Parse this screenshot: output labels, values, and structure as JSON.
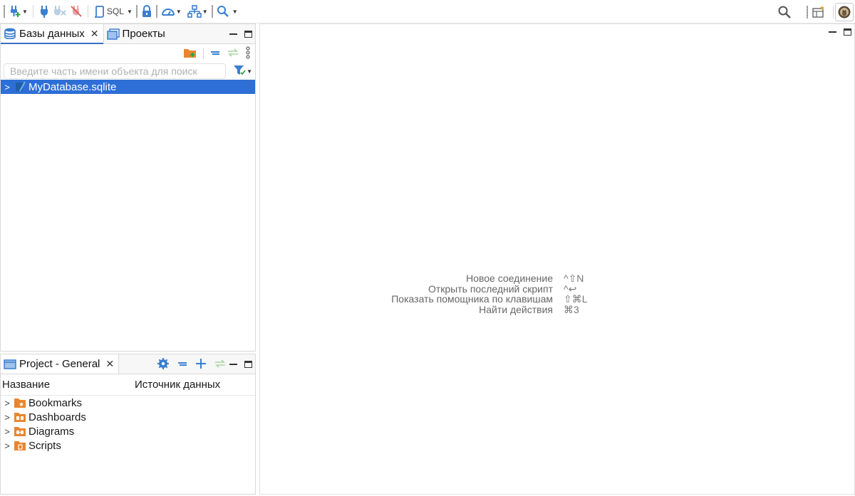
{
  "toolbar": {
    "sql_label": "SQL",
    "icons": [
      "new-connection-icon",
      "connect-icon",
      "disconnect-icon",
      "disconnect-all-icon",
      "sql-editor-icon",
      "lock-icon",
      "dashboard-icon",
      "network-icon",
      "search-icon",
      "global-search-icon",
      "perspective-icon",
      "avatar"
    ]
  },
  "left_top": {
    "tabs": [
      {
        "label": "Базы данных",
        "closable": true,
        "active": true
      },
      {
        "label": "Проекты",
        "closable": false,
        "active": false
      }
    ],
    "filter_placeholder": "Введите часть имени объекта для поиск",
    "tree": [
      {
        "label": "MyDatabase.sqlite",
        "selected": true
      }
    ]
  },
  "left_bottom": {
    "tab_label": "Project - General",
    "columns": [
      "Название",
      "Источник данных"
    ],
    "items": [
      {
        "label": "Bookmarks",
        "icon": "bookmarks-folder-icon"
      },
      {
        "label": "Dashboards",
        "icon": "dashboards-folder-icon"
      },
      {
        "label": "Diagrams",
        "icon": "diagrams-folder-icon"
      },
      {
        "label": "Scripts",
        "icon": "scripts-folder-icon"
      }
    ]
  },
  "editor": {
    "hints": [
      {
        "label": "Новое соединение",
        "shortcut": "^⇧N"
      },
      {
        "label": "Открыть последний скрипт",
        "shortcut": "^↩"
      },
      {
        "label": "Показать помощника по клавишам",
        "shortcut": "⇧⌘L"
      },
      {
        "label": "Найти действия",
        "shortcut": "⌘3"
      }
    ]
  },
  "colors": {
    "accent": "#2d6fd6",
    "folder_orange": "#e8862f",
    "icon_blue": "#3a7fd0"
  }
}
